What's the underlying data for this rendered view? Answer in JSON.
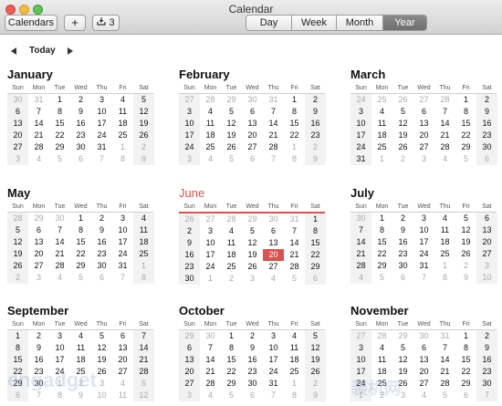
{
  "window": {
    "title": "Calendar"
  },
  "toolbar": {
    "calendars_label": "Calendars",
    "add_label": "+",
    "inbox_count": "3"
  },
  "views": [
    "Day",
    "Week",
    "Month",
    "Year"
  ],
  "active_view": "Year",
  "nav": {
    "today_label": "Today"
  },
  "weekdays": [
    "Sun",
    "Mon",
    "Tue",
    "Wed",
    "Thu",
    "Fri",
    "Sat"
  ],
  "months": [
    {
      "name": "January",
      "weeks": [
        [
          "30",
          "31",
          "1",
          "2",
          "3",
          "4",
          "5"
        ],
        [
          "6",
          "7",
          "8",
          "9",
          "10",
          "11",
          "12"
        ],
        [
          "13",
          "14",
          "15",
          "16",
          "17",
          "18",
          "19"
        ],
        [
          "20",
          "21",
          "22",
          "23",
          "24",
          "25",
          "26"
        ],
        [
          "27",
          "28",
          "29",
          "30",
          "31",
          "1",
          "2"
        ],
        [
          "3",
          "4",
          "5",
          "6",
          "7",
          "8",
          "9"
        ]
      ]
    },
    {
      "name": "February",
      "weeks": [
        [
          "27",
          "28",
          "29",
          "30",
          "31",
          "1",
          "2"
        ],
        [
          "3",
          "4",
          "5",
          "6",
          "7",
          "8",
          "9"
        ],
        [
          "10",
          "11",
          "12",
          "13",
          "14",
          "15",
          "16"
        ],
        [
          "17",
          "18",
          "19",
          "20",
          "21",
          "22",
          "23"
        ],
        [
          "24",
          "25",
          "26",
          "27",
          "28",
          "1",
          "2"
        ],
        [
          "3",
          "4",
          "5",
          "6",
          "7",
          "8",
          "9"
        ]
      ]
    },
    {
      "name": "March",
      "weeks": [
        [
          "24",
          "25",
          "26",
          "27",
          "28",
          "1",
          "2"
        ],
        [
          "3",
          "4",
          "5",
          "6",
          "7",
          "8",
          "9"
        ],
        [
          "10",
          "11",
          "12",
          "13",
          "14",
          "15",
          "16"
        ],
        [
          "17",
          "18",
          "19",
          "20",
          "21",
          "22",
          "23"
        ],
        [
          "24",
          "25",
          "26",
          "27",
          "28",
          "29",
          "30"
        ],
        [
          "31",
          "1",
          "2",
          "3",
          "4",
          "5",
          "6"
        ]
      ]
    },
    {
      "name": "May",
      "weeks": [
        [
          "28",
          "29",
          "30",
          "1",
          "2",
          "3",
          "4"
        ],
        [
          "5",
          "6",
          "7",
          "8",
          "9",
          "10",
          "11"
        ],
        [
          "12",
          "13",
          "14",
          "15",
          "16",
          "17",
          "18"
        ],
        [
          "19",
          "20",
          "21",
          "22",
          "23",
          "24",
          "25"
        ],
        [
          "26",
          "27",
          "28",
          "29",
          "30",
          "31",
          "1"
        ],
        [
          "2",
          "3",
          "4",
          "5",
          "6",
          "7",
          "8"
        ]
      ]
    },
    {
      "name": "June",
      "current": true,
      "weeks": [
        [
          "26",
          "27",
          "28",
          "29",
          "30",
          "31",
          "1"
        ],
        [
          "2",
          "3",
          "4",
          "5",
          "6",
          "7",
          "8"
        ],
        [
          "9",
          "10",
          "11",
          "12",
          "13",
          "14",
          "15"
        ],
        [
          "16",
          "17",
          "18",
          "19",
          "20",
          "21",
          "22"
        ],
        [
          "23",
          "24",
          "25",
          "26",
          "27",
          "28",
          "29"
        ],
        [
          "30",
          "1",
          "2",
          "3",
          "4",
          "5",
          "6"
        ]
      ]
    },
    {
      "name": "July",
      "weeks": [
        [
          "30",
          "1",
          "2",
          "3",
          "4",
          "5",
          "6"
        ],
        [
          "7",
          "8",
          "9",
          "10",
          "11",
          "12",
          "13"
        ],
        [
          "14",
          "15",
          "16",
          "17",
          "18",
          "19",
          "20"
        ],
        [
          "21",
          "22",
          "23",
          "24",
          "25",
          "26",
          "27"
        ],
        [
          "28",
          "29",
          "30",
          "31",
          "1",
          "2",
          "3"
        ],
        [
          "4",
          "5",
          "6",
          "7",
          "8",
          "9",
          "10"
        ]
      ]
    },
    {
      "name": "September",
      "weeks": [
        [
          "1",
          "2",
          "3",
          "4",
          "5",
          "6",
          "7"
        ],
        [
          "8",
          "9",
          "10",
          "11",
          "12",
          "13",
          "14"
        ],
        [
          "15",
          "16",
          "17",
          "18",
          "19",
          "20",
          "21"
        ],
        [
          "22",
          "23",
          "24",
          "25",
          "26",
          "27",
          "28"
        ],
        [
          "29",
          "30",
          "1",
          "2",
          "3",
          "4",
          "5"
        ],
        [
          "6",
          "7",
          "8",
          "9",
          "10",
          "11",
          "12"
        ]
      ]
    },
    {
      "name": "October",
      "weeks": [
        [
          "29",
          "30",
          "1",
          "2",
          "3",
          "4",
          "5"
        ],
        [
          "6",
          "7",
          "8",
          "9",
          "10",
          "11",
          "12"
        ],
        [
          "13",
          "14",
          "15",
          "16",
          "17",
          "18",
          "19"
        ],
        [
          "20",
          "21",
          "22",
          "23",
          "24",
          "25",
          "26"
        ],
        [
          "27",
          "28",
          "29",
          "30",
          "31",
          "1",
          "2"
        ],
        [
          "3",
          "4",
          "5",
          "6",
          "7",
          "8",
          "9"
        ]
      ]
    },
    {
      "name": "November",
      "weeks": [
        [
          "27",
          "28",
          "29",
          "30",
          "31",
          "1",
          "2"
        ],
        [
          "3",
          "4",
          "5",
          "6",
          "7",
          "8",
          "9"
        ],
        [
          "10",
          "11",
          "12",
          "13",
          "14",
          "15",
          "16"
        ],
        [
          "17",
          "18",
          "19",
          "20",
          "21",
          "22",
          "23"
        ],
        [
          "24",
          "25",
          "26",
          "27",
          "28",
          "29",
          "30"
        ],
        [
          "1",
          "2",
          "3",
          "4",
          "5",
          "6",
          "7"
        ]
      ]
    }
  ],
  "today": {
    "month": "June",
    "day": "20"
  },
  "watermarks": {
    "left": "engadget",
    "right": "装机网"
  },
  "colors": {
    "accent": "#d9534f",
    "weekend_bg": "#f2f2f2",
    "dim_text": "#aaaaaa"
  }
}
